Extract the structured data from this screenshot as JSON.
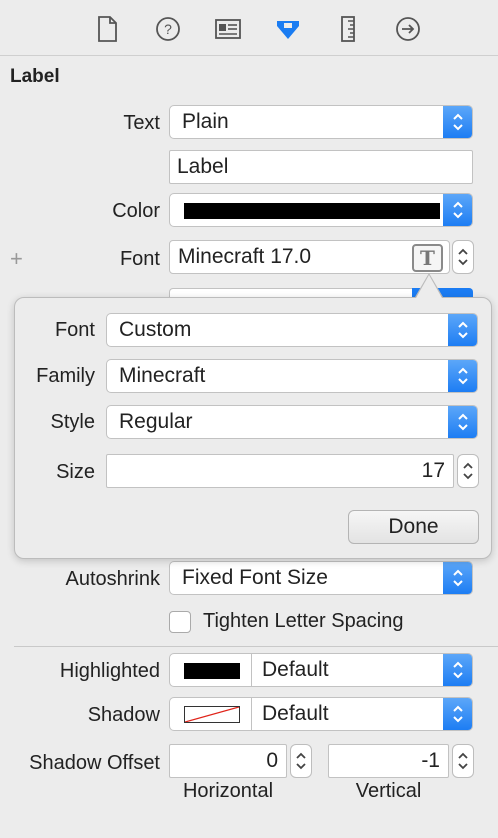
{
  "toolbar": {
    "tabs": [
      {
        "icon": "file-inspector-icon"
      },
      {
        "icon": "quick-help-icon"
      },
      {
        "icon": "identity-inspector-icon"
      },
      {
        "icon": "attributes-inspector-icon",
        "active": true
      },
      {
        "icon": "size-inspector-icon"
      },
      {
        "icon": "connections-inspector-icon"
      }
    ]
  },
  "section": {
    "title": "Label"
  },
  "text": {
    "label": "Text",
    "value": "Plain",
    "content": "Label"
  },
  "color": {
    "label": "Color",
    "swatch": "#000000"
  },
  "font": {
    "label": "Font",
    "value": "Minecraft 17.0",
    "plus": "+",
    "button_glyph": "T"
  },
  "popover": {
    "font": {
      "label": "Font",
      "value": "Custom"
    },
    "family": {
      "label": "Family",
      "value": "Minecraft"
    },
    "style": {
      "label": "Style",
      "value": "Regular"
    },
    "size": {
      "label": "Size",
      "value": "17"
    },
    "done": "Done"
  },
  "autoshrink": {
    "label": "Autoshrink",
    "value": "Fixed Font Size"
  },
  "tighten": {
    "label": "Tighten Letter Spacing",
    "checked": false
  },
  "highlighted": {
    "label": "Highlighted",
    "value": "Default",
    "swatch": "#000000"
  },
  "shadow": {
    "label": "Shadow",
    "value": "Default"
  },
  "shadow_offset": {
    "label": "Shadow Offset",
    "horizontal": {
      "value": "0",
      "label": "Horizontal"
    },
    "vertical": {
      "value": "-1",
      "label": "Vertical"
    }
  },
  "colors": {
    "accent": "#1b7cf3",
    "active_tab": "#1a7cf2"
  }
}
